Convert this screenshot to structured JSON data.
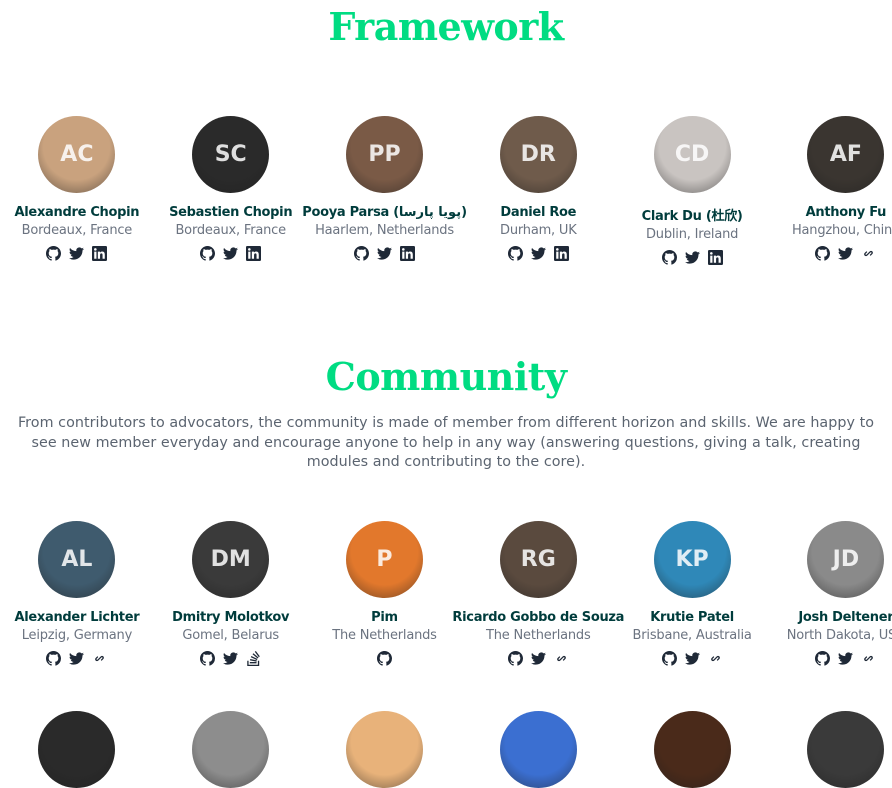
{
  "framework": {
    "title": "Framework",
    "members": [
      {
        "name": "Alexandre Chopin",
        "location": "Bordeaux, France",
        "socials": [
          "github",
          "twitter",
          "linkedin"
        ],
        "initials": "AC",
        "color": "#c9a27e"
      },
      {
        "name": "Sebastien Chopin",
        "location": "Bordeaux, France",
        "socials": [
          "github",
          "twitter",
          "linkedin"
        ],
        "initials": "SC",
        "color": "#2a2a2a"
      },
      {
        "name": "Pooya Parsa (پویا پارسا)",
        "location": "Haarlem, Netherlands",
        "socials": [
          "github",
          "twitter",
          "linkedin"
        ],
        "initials": "PP",
        "color": "#7a5a46"
      },
      {
        "name": "Daniel Roe",
        "location": "Durham, UK",
        "socials": [
          "github",
          "twitter",
          "linkedin"
        ],
        "initials": "DR",
        "color": "#6f5b4b"
      },
      {
        "name": "Clark Du (杜欣)",
        "location": "Dublin, Ireland",
        "socials": [
          "github",
          "twitter",
          "linkedin"
        ],
        "initials": "CD",
        "color": "#c9c4c1"
      },
      {
        "name": "Anthony Fu",
        "location": "Hangzhou, China",
        "socials": [
          "github",
          "twitter",
          "link"
        ],
        "initials": "AF",
        "color": "#3a3530"
      }
    ]
  },
  "community": {
    "title": "Community",
    "description": "From contributors to advocators, the community is made of member from different horizon and skills. We are happy to see new member everyday and encourage anyone to help in any way (answering questions, giving a talk, creating modules and contributing to the core).",
    "members": [
      {
        "name": "Alexander Lichter",
        "location": "Leipzig, Germany",
        "socials": [
          "github",
          "twitter",
          "link"
        ],
        "initials": "AL",
        "color": "#3f5b6e"
      },
      {
        "name": "Dmitry Molotkov",
        "location": "Gomel, Belarus",
        "socials": [
          "github",
          "twitter",
          "stackoverflow"
        ],
        "initials": "DM",
        "color": "#3a3a3a"
      },
      {
        "name": "Pim",
        "location": "The Netherlands",
        "socials": [
          "github"
        ],
        "initials": "P",
        "color": "#e2782c"
      },
      {
        "name": "Ricardo Gobbo de Souza",
        "location": "The Netherlands",
        "socials": [
          "github",
          "twitter",
          "link"
        ],
        "initials": "RG",
        "color": "#5a4a3e"
      },
      {
        "name": "Krutie Patel",
        "location": "Brisbane, Australia",
        "socials": [
          "github",
          "twitter",
          "link"
        ],
        "initials": "KP",
        "color": "#2f88b8"
      },
      {
        "name": "Josh Deltener",
        "location": "North Dakota, USA",
        "socials": [
          "github",
          "twitter",
          "link"
        ],
        "initials": "JD",
        "color": "#8a8a8a"
      }
    ],
    "next_row_avatars": [
      {
        "initials": "",
        "color": "#2a2a2a"
      },
      {
        "initials": "",
        "color": "#8d8d8d"
      },
      {
        "initials": "",
        "color": "#e8b27a"
      },
      {
        "initials": "",
        "color": "#3b6fd1"
      },
      {
        "initials": "",
        "color": "#4a2a1a"
      },
      {
        "initials": "",
        "color": "#3a3a3a"
      }
    ]
  },
  "icons": {
    "github": "github-icon",
    "twitter": "twitter-icon",
    "linkedin": "linkedin-icon",
    "link": "link-icon",
    "stackoverflow": "stackoverflow-icon"
  },
  "colors": {
    "accent": "#00dc82",
    "name": "#003c3c",
    "location": "#6b7380",
    "description": "#5b6470"
  }
}
